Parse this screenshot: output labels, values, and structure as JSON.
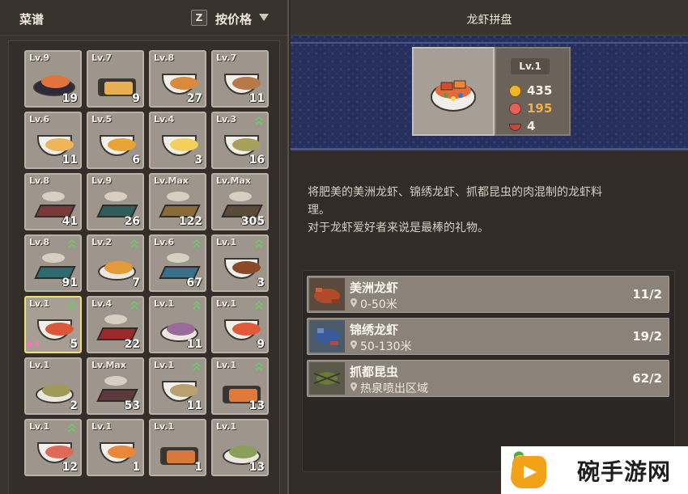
{
  "left_panel": {
    "title": "菜谱",
    "sort_key": "Z",
    "sort_label": "按价格"
  },
  "recipes": [
    {
      "level": "Lv.9",
      "count": "19",
      "upgrade": false,
      "selected": false,
      "kind": "platter",
      "color": "#e0743c"
    },
    {
      "level": "Lv.7",
      "count": "9",
      "upgrade": false,
      "selected": false,
      "kind": "tray",
      "color": "#e6b04e"
    },
    {
      "level": "Lv.8",
      "count": "27",
      "upgrade": false,
      "selected": false,
      "kind": "bowl",
      "color": "#d98a3c"
    },
    {
      "level": "Lv.7",
      "count": "11",
      "upgrade": false,
      "selected": false,
      "kind": "bowl",
      "color": "#b8794a"
    },
    {
      "level": "Lv.6",
      "count": "11",
      "upgrade": false,
      "selected": false,
      "kind": "bowl",
      "color": "#f0b45a"
    },
    {
      "level": "Lv.5",
      "count": "6",
      "upgrade": false,
      "selected": false,
      "kind": "bowl",
      "color": "#e9a437"
    },
    {
      "level": "Lv.4",
      "count": "3",
      "upgrade": false,
      "selected": false,
      "kind": "bowl",
      "color": "#f3cf5c"
    },
    {
      "level": "Lv.3",
      "count": "16",
      "upgrade": true,
      "selected": false,
      "kind": "bowl",
      "color": "#a7a05a"
    },
    {
      "level": "Lv.8",
      "count": "41",
      "upgrade": false,
      "selected": false,
      "kind": "stand",
      "color": "#7a3a3a"
    },
    {
      "level": "Lv.9",
      "count": "26",
      "upgrade": false,
      "selected": false,
      "kind": "stand",
      "color": "#2f5e5a"
    },
    {
      "level": "Lv.Max",
      "count": "122",
      "upgrade": false,
      "selected": false,
      "kind": "stand",
      "color": "#8b6a3a"
    },
    {
      "level": "Lv.Max",
      "count": "305",
      "upgrade": false,
      "selected": false,
      "kind": "stand",
      "color": "#5a4a3a"
    },
    {
      "level": "Lv.8",
      "count": "91",
      "upgrade": true,
      "selected": false,
      "kind": "stand",
      "color": "#2d6b70"
    },
    {
      "level": "Lv.2",
      "count": "7",
      "upgrade": true,
      "selected": false,
      "kind": "plate",
      "color": "#e59a3a"
    },
    {
      "level": "Lv.6",
      "count": "67",
      "upgrade": true,
      "selected": false,
      "kind": "stand",
      "color": "#3a6f8a"
    },
    {
      "level": "Lv.1",
      "count": "3",
      "upgrade": true,
      "selected": false,
      "kind": "bowl",
      "color": "#8a4a2a"
    },
    {
      "level": "Lv.1",
      "count": "5",
      "upgrade": true,
      "selected": true,
      "kind": "bowl",
      "color": "#d9583a"
    },
    {
      "level": "Lv.4",
      "count": "22",
      "upgrade": true,
      "selected": false,
      "kind": "stand",
      "color": "#9a2a2a"
    },
    {
      "level": "Lv.1",
      "count": "11",
      "upgrade": true,
      "selected": false,
      "kind": "plate",
      "color": "#9a6a9a"
    },
    {
      "level": "Lv.1",
      "count": "9",
      "upgrade": true,
      "selected": false,
      "kind": "bowl",
      "color": "#e05a3a"
    },
    {
      "level": "Lv.1",
      "count": "2",
      "upgrade": false,
      "selected": false,
      "kind": "plate",
      "color": "#a09a5a"
    },
    {
      "level": "Lv.Max",
      "count": "53",
      "upgrade": false,
      "selected": false,
      "kind": "stand",
      "color": "#5a3a3a"
    },
    {
      "level": "Lv.1",
      "count": "11",
      "upgrade": true,
      "selected": false,
      "kind": "bowl",
      "color": "#b8a070"
    },
    {
      "level": "Lv.1",
      "count": "13",
      "upgrade": true,
      "selected": false,
      "kind": "tray",
      "color": "#e07a3a"
    },
    {
      "level": "Lv.1",
      "count": "12",
      "upgrade": true,
      "selected": false,
      "kind": "bowl",
      "color": "#e06a5a"
    },
    {
      "level": "Lv.1",
      "count": "1",
      "upgrade": false,
      "selected": false,
      "kind": "bowl",
      "color": "#e8883a"
    },
    {
      "level": "Lv.1",
      "count": "1",
      "upgrade": false,
      "selected": false,
      "kind": "tray",
      "color": "#d9783a"
    },
    {
      "level": "Lv.1",
      "count": "13",
      "upgrade": false,
      "selected": false,
      "kind": "plate",
      "color": "#8aa05a"
    }
  ],
  "detail": {
    "title": "龙虾拼盘",
    "level": "Lv.1",
    "price": "435",
    "appeal": "195",
    "portions": "4",
    "description_line1": "将肥美的美洲龙虾、锦绣龙虾、抓都昆虫的肉混制的龙虾料",
    "description_line2": "理。",
    "description_line3": "对于龙虾爱好者来说是最棒的礼物。"
  },
  "ingredients": [
    {
      "name": "美洲龙虾",
      "location": "0-50米",
      "count": "11/2",
      "icon": "american-lobster-icon"
    },
    {
      "name": "锦绣龙虾",
      "location": "50-130米",
      "count": "19/2",
      "icon": "ornate-lobster-icon"
    },
    {
      "name": "抓都昆虫",
      "location": "热泉喷出区域",
      "count": "62/2",
      "icon": "crab-insect-icon"
    }
  ],
  "watermark": {
    "text": "碗手游网"
  },
  "colors": {
    "upgrade_arrow": "#5fd35a",
    "selected_border": "#f3dc7a",
    "banner": "#27305a",
    "price_coin": "#f0b429",
    "appeal_value": "#f0b04a"
  }
}
